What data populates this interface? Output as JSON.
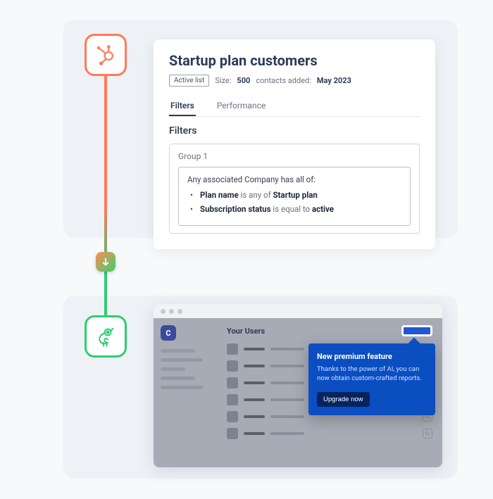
{
  "icons": {
    "hubspot": "#ff7a59",
    "chameleon": "#2ecc71"
  },
  "hubspot_card": {
    "title": "Startup plan customers",
    "badge": "Active list",
    "size_label": "Size:",
    "size_value": "500",
    "contacts_added_label": "contacts added:",
    "contacts_added_value": "May 2023",
    "tabs": {
      "filters": "Filters",
      "performance": "Performance"
    },
    "section_title": "Filters",
    "group_title": "Group 1",
    "rule_intro": "Any associated Company has all of:",
    "rules": [
      {
        "field": "Plan name",
        "op": "is any of",
        "value": "Startup plan"
      },
      {
        "field": "Subscription status",
        "op": "is equal to",
        "value": "active"
      }
    ]
  },
  "app": {
    "avatar_letter": "C",
    "header": "Your Users",
    "tooltip": {
      "title": "New premium feature",
      "body": "Thanks to the power of AI, you can now obtain custom-crafted reports.",
      "cta": "Upgrade now"
    }
  }
}
